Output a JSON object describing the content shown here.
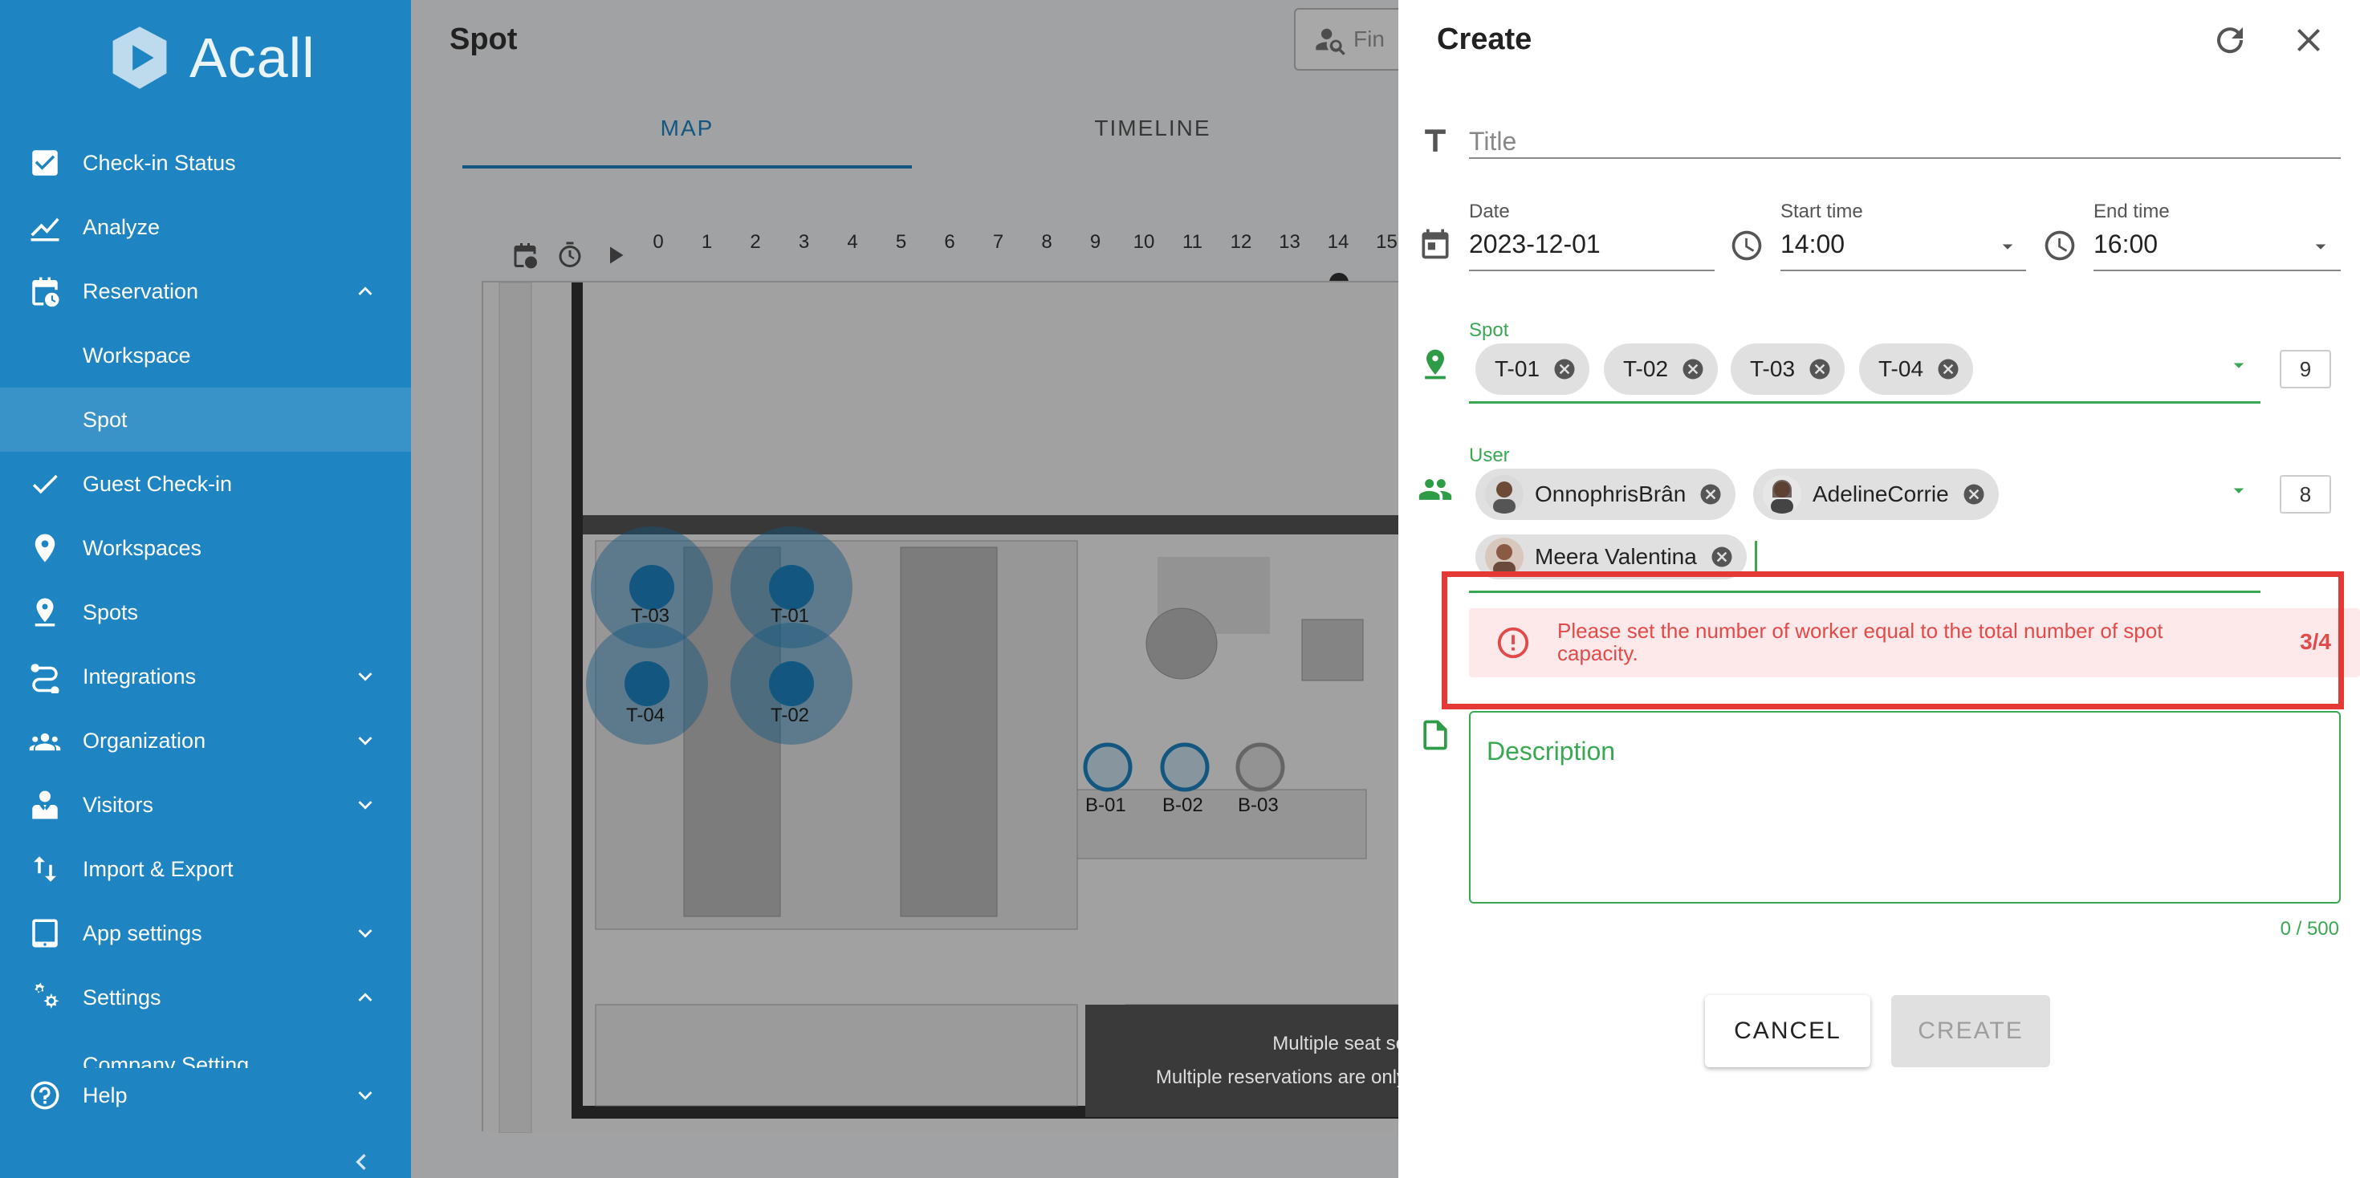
{
  "app": {
    "brand": "Acall",
    "colors": {
      "sidebar": "#1e84c2",
      "accent_green": "#3aa853",
      "error": "#e24a4a"
    }
  },
  "sidebar": {
    "items": [
      {
        "label": "Check-in Status",
        "icon": "checkbox-icon"
      },
      {
        "label": "Analyze",
        "icon": "chart-icon"
      },
      {
        "label": "Reservation",
        "icon": "calendar-clock-icon",
        "expanded": true
      },
      {
        "label": "Workspace",
        "sub": true
      },
      {
        "label": "Spot",
        "sub": true,
        "active": true
      },
      {
        "label": "Guest Check-in",
        "icon": "check-icon"
      },
      {
        "label": "Workspaces",
        "icon": "location-pin-icon"
      },
      {
        "label": "Spots",
        "icon": "location-pin-outline-icon"
      },
      {
        "label": "Integrations",
        "icon": "integration-icon",
        "expanded": false
      },
      {
        "label": "Organization",
        "icon": "people-icon",
        "expanded": false
      },
      {
        "label": "Visitors",
        "icon": "visitor-icon",
        "expanded": false
      },
      {
        "label": "Import & Export",
        "icon": "import-export-icon"
      },
      {
        "label": "App settings",
        "icon": "tablet-icon",
        "expanded": false
      },
      {
        "label": "Settings",
        "icon": "gears-icon",
        "expanded": true
      },
      {
        "label": "Company Setting",
        "sub": true
      }
    ],
    "help": "Help"
  },
  "main": {
    "title": "Spot",
    "search_placeholder": "Fin",
    "tabs": [
      "MAP",
      "TIMELINE"
    ],
    "timeline_hours": [
      "0",
      "1",
      "2",
      "3",
      "4",
      "5",
      "6",
      "7",
      "8",
      "9",
      "10",
      "11",
      "12",
      "13",
      "14",
      "15"
    ],
    "spots": [
      "T-03",
      "T-01",
      "T-04",
      "T-02",
      "B-01",
      "B-02",
      "B-03"
    ],
    "toast_line1": "Multiple seat se",
    "toast_line2": "Multiple reservations are only"
  },
  "dialog": {
    "title": "Create",
    "title_placeholder": "Title",
    "date_label": "Date",
    "date_value": "2023-12-01",
    "start_label": "Start time",
    "start_value": "14:00",
    "end_label": "End time",
    "end_value": "16:00",
    "spot_label": "Spot",
    "spot_chips": [
      "T-01",
      "T-02",
      "T-03",
      "T-04"
    ],
    "spot_count": "9",
    "user_label": "User",
    "user_chips": [
      "OnnophrisBrân",
      "AdelineCorrie",
      "Meera Valentina"
    ],
    "user_count": "8",
    "error_message": "Please set the number of worker equal to the total number of spot capacity.",
    "error_count": "3/4",
    "description_placeholder": "Description",
    "description_count": "0 / 500",
    "cancel_label": "CANCEL",
    "create_label": "CREATE"
  }
}
